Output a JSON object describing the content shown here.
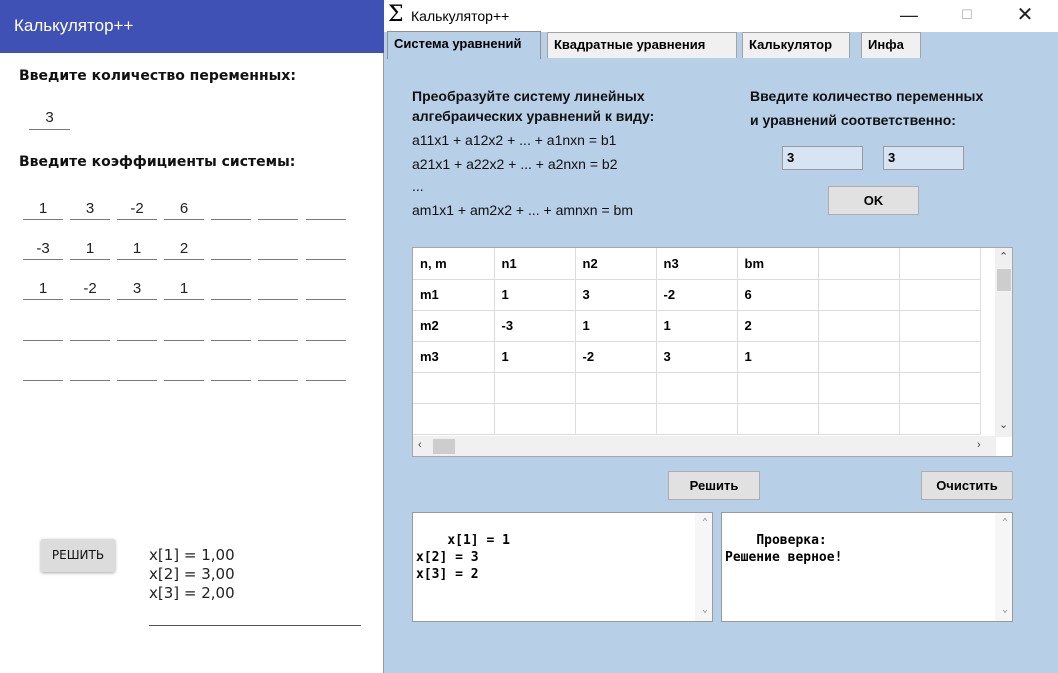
{
  "left_app": {
    "title": "Калькулятор++",
    "var_count_label": "Введите количество переменных:",
    "var_count_value": "3",
    "coef_label": "Введите коэффициенты системы:",
    "coefficients": [
      [
        "1",
        "3",
        "-2",
        "6",
        "",
        "",
        ""
      ],
      [
        "-3",
        "1",
        "1",
        "2",
        "",
        "",
        ""
      ],
      [
        "1",
        "-2",
        "3",
        "1",
        "",
        "",
        ""
      ],
      [
        "",
        "",
        "",
        "",
        "",
        "",
        ""
      ],
      [
        "",
        "",
        "",
        "",
        "",
        "",
        ""
      ]
    ],
    "solve_button": "РЕШИТЬ",
    "result_lines": [
      "x[1] = 1,00",
      "x[2] = 3,00",
      "x[3] = 2,00"
    ]
  },
  "window": {
    "icon": "Σ",
    "title": "Калькулятор++",
    "min_symbol": "—",
    "max_symbol": "☐",
    "close_symbol": "✕",
    "tabs": [
      "Система уравнений",
      "Квадратные уравнения",
      "Калькулятор",
      "Инфа"
    ],
    "active_tab": 0,
    "instructions_header": [
      "Преобразуйте систему линейных",
      "алгебраических уравнений к виду:"
    ],
    "equations": [
      "a11x1 + a12x2 + ... + a1nxn = b1",
      "a21x1 + a22x2 + ... + a2nxn = b2",
      "...",
      "am1x1 + am2x2 + ... + amnxn = bm"
    ],
    "count_label": [
      "Введите количество переменных",
      "и уравнений соответственно:"
    ],
    "n_value": "3",
    "m_value": "3",
    "ok_button": "OK",
    "grid": {
      "rows": [
        [
          "n, m",
          "n1",
          "n2",
          "n3",
          "bm",
          "",
          ""
        ],
        [
          "m1",
          "1",
          "3",
          "-2",
          "6",
          "",
          ""
        ],
        [
          "m2",
          "-3",
          "1",
          "1",
          "2",
          "",
          ""
        ],
        [
          "m3",
          "1",
          "-2",
          "3",
          "1",
          "",
          ""
        ],
        [
          "",
          "",
          "",
          "",
          "",
          "",
          ""
        ],
        [
          "",
          "",
          "",
          "",
          "",
          "",
          ""
        ]
      ]
    },
    "solve_button": "Решить",
    "clear_button": "Очистить",
    "output_left": "x[1] = 1\nx[2] = 3\nx[3] = 2",
    "output_right": "Проверка:\nРешение верное!",
    "colors": {
      "background": "#b8cfe8",
      "appbar": "#3f51b5"
    }
  }
}
